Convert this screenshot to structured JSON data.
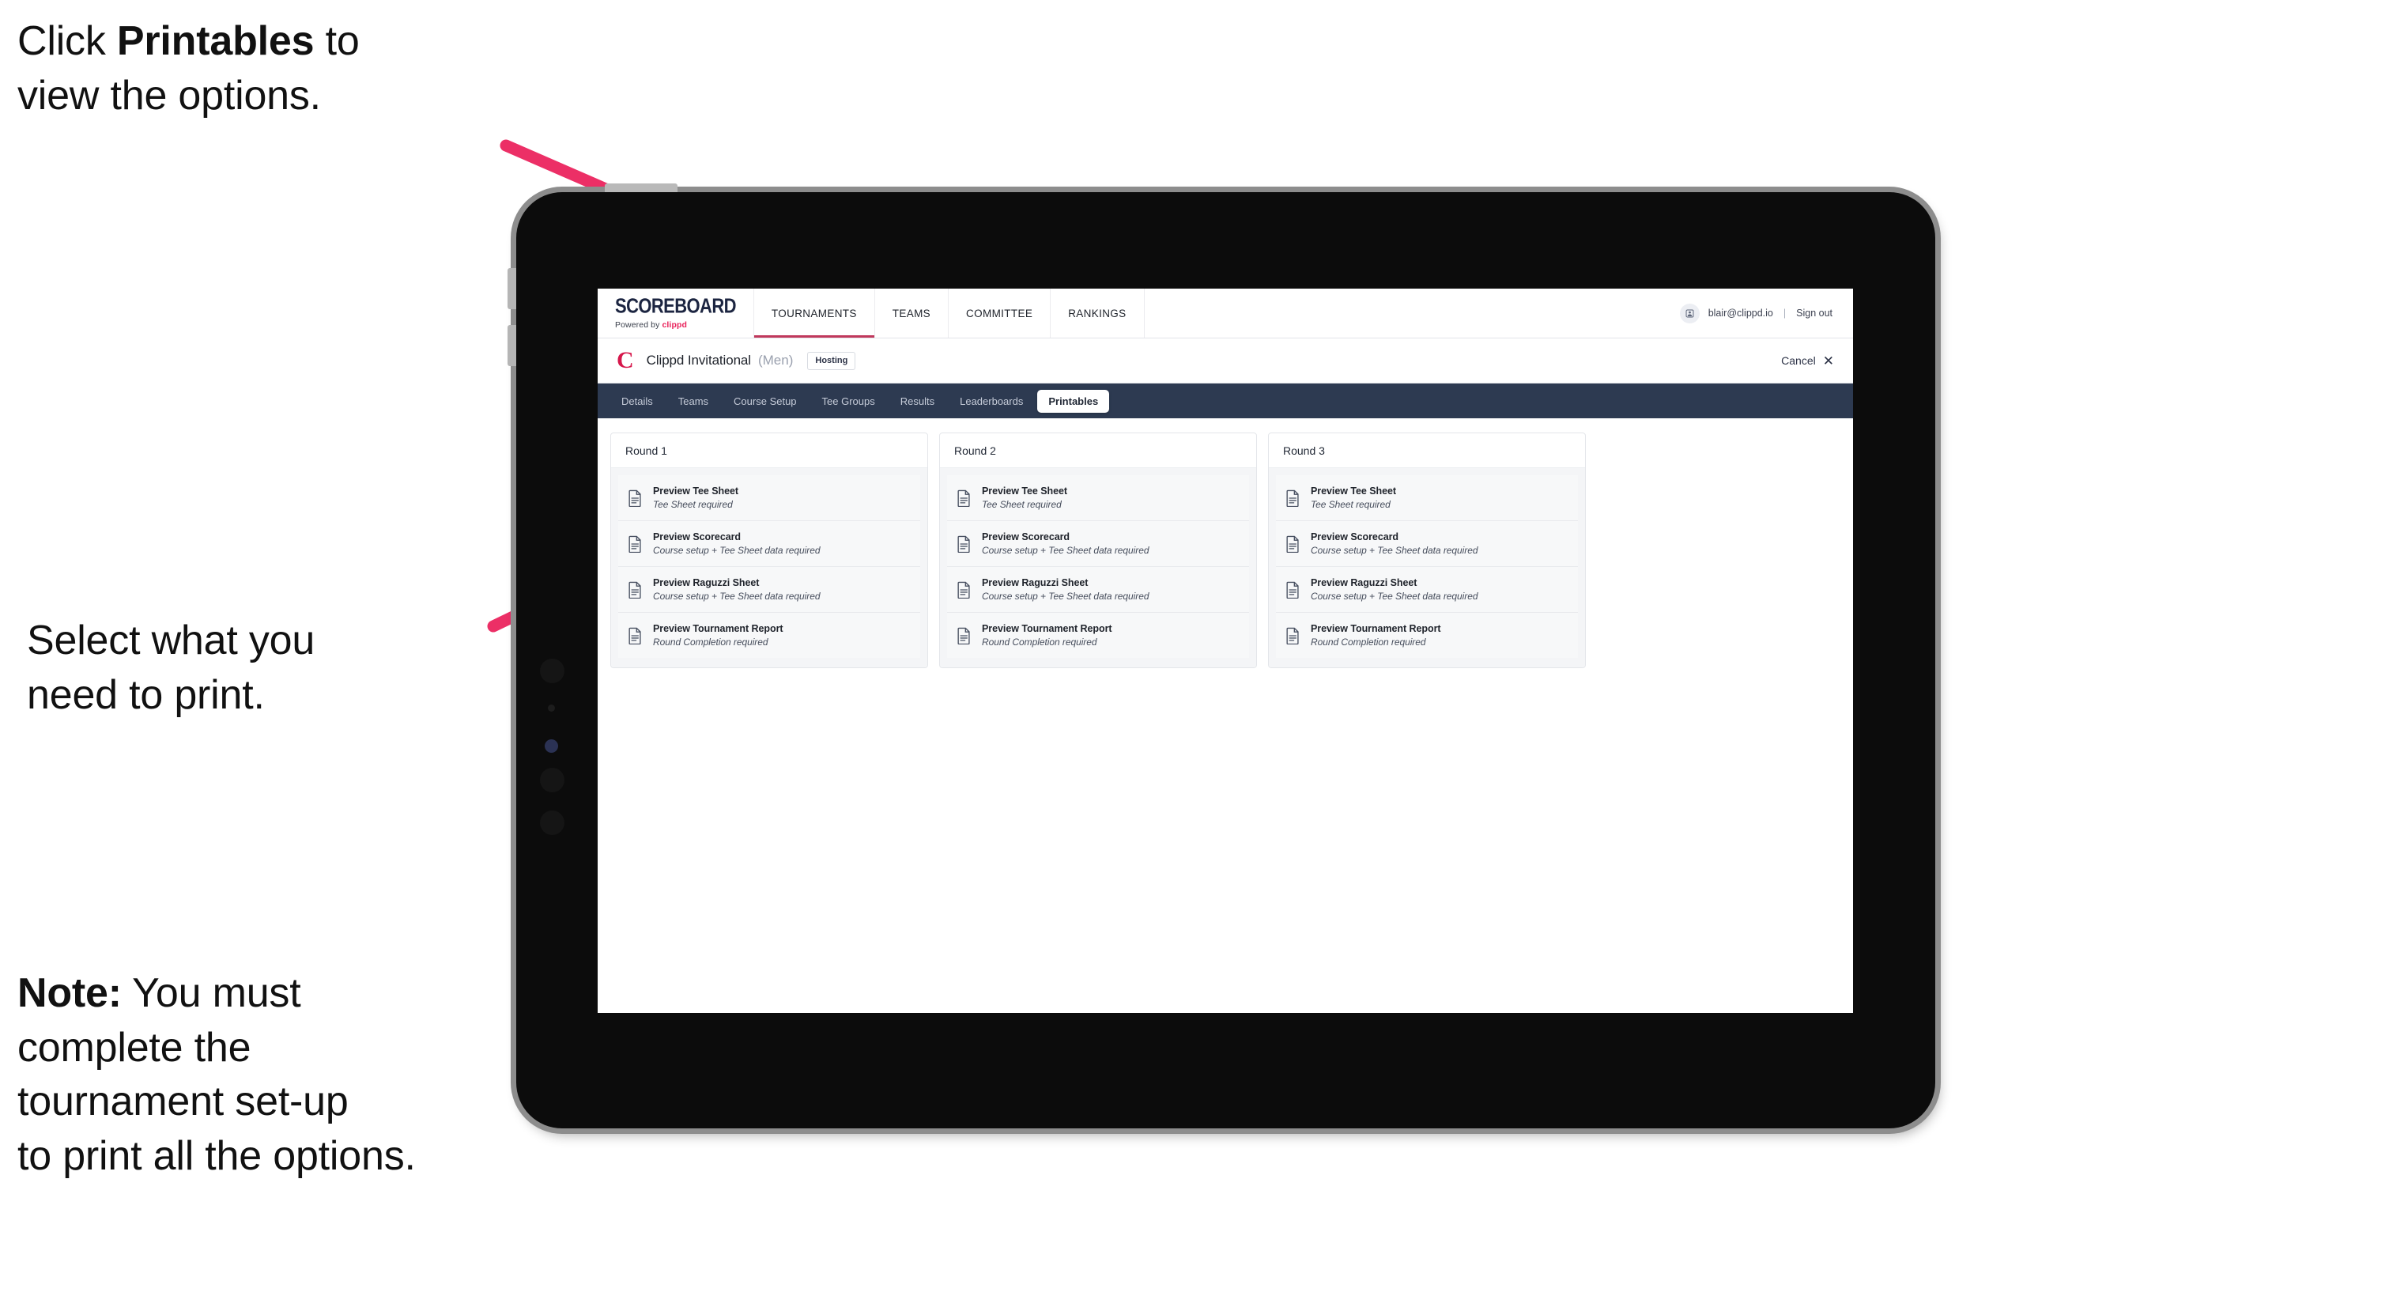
{
  "annotations": {
    "top": {
      "prefix": "Click ",
      "bold": "Printables",
      "suffix": " to\nview the options."
    },
    "middle": "Select what you\n need to print.",
    "note": {
      "bold": "Note:",
      "rest": " You must\ncomplete the\ntournament set-up\nto print all the options."
    }
  },
  "app": {
    "brand": {
      "title": "SCOREBOARD",
      "powered_prefix": "Powered by ",
      "powered_name": "clippd"
    },
    "topnav": [
      {
        "label": "TOURNAMENTS",
        "active": true
      },
      {
        "label": "TEAMS",
        "active": false
      },
      {
        "label": "COMMITTEE",
        "active": false
      },
      {
        "label": "RANKINGS",
        "active": false
      }
    ],
    "user": {
      "avatar_icon": "user-avatar-icon",
      "email": "blair@clippd.io",
      "separator": "|",
      "sign_out": "Sign out"
    },
    "tournament": {
      "logo_letter": "C",
      "name": "Clippd Invitational",
      "gender": "(Men)",
      "status": "Hosting",
      "cancel_label": "Cancel",
      "cancel_icon": "close-x-icon"
    },
    "section_tabs": [
      {
        "label": "Details",
        "active": false
      },
      {
        "label": "Teams",
        "active": false
      },
      {
        "label": "Course Setup",
        "active": false
      },
      {
        "label": "Tee Groups",
        "active": false
      },
      {
        "label": "Results",
        "active": false
      },
      {
        "label": "Leaderboards",
        "active": false
      },
      {
        "label": "Printables",
        "active": true
      }
    ],
    "rounds": [
      {
        "title": "Round 1",
        "items": [
          {
            "title": "Preview Tee Sheet",
            "sub": "Tee Sheet required"
          },
          {
            "title": "Preview Scorecard",
            "sub": "Course setup + Tee Sheet data required"
          },
          {
            "title": "Preview Raguzzi Sheet",
            "sub": "Course setup + Tee Sheet data required"
          },
          {
            "title": "Preview Tournament Report",
            "sub": "Round Completion required"
          }
        ]
      },
      {
        "title": "Round 2",
        "items": [
          {
            "title": "Preview Tee Sheet",
            "sub": "Tee Sheet required"
          },
          {
            "title": "Preview Scorecard",
            "sub": "Course setup + Tee Sheet data required"
          },
          {
            "title": "Preview Raguzzi Sheet",
            "sub": "Course setup + Tee Sheet data required"
          },
          {
            "title": "Preview Tournament Report",
            "sub": "Round Completion required"
          }
        ]
      },
      {
        "title": "Round 3",
        "items": [
          {
            "title": "Preview Tee Sheet",
            "sub": "Tee Sheet required"
          },
          {
            "title": "Preview Scorecard",
            "sub": "Course setup + Tee Sheet data required"
          },
          {
            "title": "Preview Raguzzi Sheet",
            "sub": "Course setup + Tee Sheet data required"
          },
          {
            "title": "Preview Tournament Report",
            "sub": "Round Completion required"
          }
        ]
      }
    ]
  },
  "colors": {
    "accent_pink": "#ec2f66",
    "brand_red": "#d6174b",
    "navbar_dark": "#2d3a51",
    "device_body": "#0c0c0c",
    "device_edge": "#8d8d8d"
  }
}
